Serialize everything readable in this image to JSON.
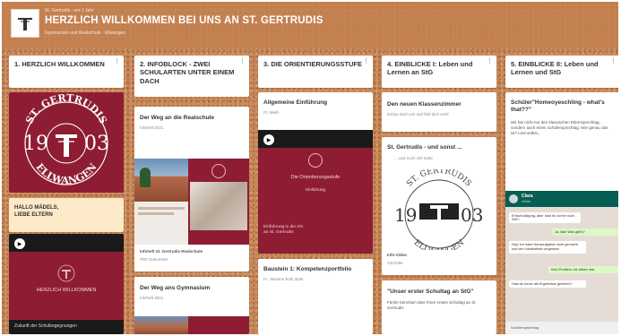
{
  "header": {
    "meta": "St. Gertrudis · vor 1 Jahr",
    "title": "HERZLICH WILLKOMMEN BEI UNS AN ST. GERTRUDIS",
    "subtitle": "Gymnasium und Realschule · Ellwangen"
  },
  "columns": [
    {
      "title": "1. HERZLICH WILLKOMMEN"
    },
    {
      "title": "2. INFOBLOCK - ZWEI SCHULARTEN UNTER EINEM DACH"
    },
    {
      "title": "3. DIE ORIENTIERUNGSSTUFE"
    },
    {
      "title": "4. EINBLICKE I: Leben und Lernen an StG"
    },
    {
      "title": "5. EINBLICKE II: Leben und Lernen und StG"
    }
  ],
  "seal": {
    "top": "ST. GERTRUDIS",
    "left": "19",
    "right": "03",
    "bottom": "ELLWANGEN"
  },
  "col1": {
    "hello_line1": "HALLO MÄDELS,",
    "hello_line2": "LIEBE ELTERN",
    "video_title": "HERZLICH WILLKOMMEN",
    "video_caption": "Zukunft der Schulbegegnungen"
  },
  "col2": {
    "card1_title": "Der Weg an die Realschule",
    "card1_sub": "Infoheft 2021",
    "card1_caption": "Infoheft St. Gertrudis Realschule",
    "card1_file": "PDF Dokument",
    "card2_title": "Der Weg ans Gymnasium",
    "card2_sub": "Infoheft 2021"
  },
  "col3": {
    "card1_title": "Allgemeine Einführung",
    "card1_sub": "Fr. Weiß",
    "video_title": "Die Orientierungsstufe",
    "video_sub": "Einführung",
    "video_caption": "Einführung in die OS",
    "video_caption2": "an St. Gertrudis",
    "card2_title": "Baustein 1: Kompetenzportfolio",
    "card2_sub": "Fr. Jasmine Erdt, Bahr"
  },
  "col4": {
    "card1_title": "Den neuen Klassenzimmer",
    "card1_sub": "Schau doch um und fühl dich wohl",
    "card2_title": "St. Gertrudis - und sonst ...",
    "card2_sub": "... und noch viel mehr",
    "card2_caption": "Info-Video",
    "card2_file": "YouTube",
    "card3_title": "\"Unser erster Schultag an StG\"",
    "card3_body": "Fünfer berichten über ihren ersten Schultag an St. Gertrudis"
  },
  "col5": {
    "card1_title": "Schüler\"Homeoyeschling - what's that??\"",
    "card1_body": "Wir bei nicht nur den klassischen Elternsprechtag, sondern auch einen Schülersprechtag. Wie genau das ist? Lest selbst...",
    "chat_name": "Clara",
    "chat_status": "online",
    "chat_messages": [
      "Entschuldigung, aber hast du vorher noch Zeit?",
      "Ja, klar! Was gibt's?",
      "Hey! Ich habe Hausaufgaben nicht gemacht und den Vokabeltest vergessen",
      "Kein Problem, wir klären das",
      "Hast du heute die Ergebnisse gesehen?"
    ],
    "chat_bottom": "Schülersprechtag"
  }
}
